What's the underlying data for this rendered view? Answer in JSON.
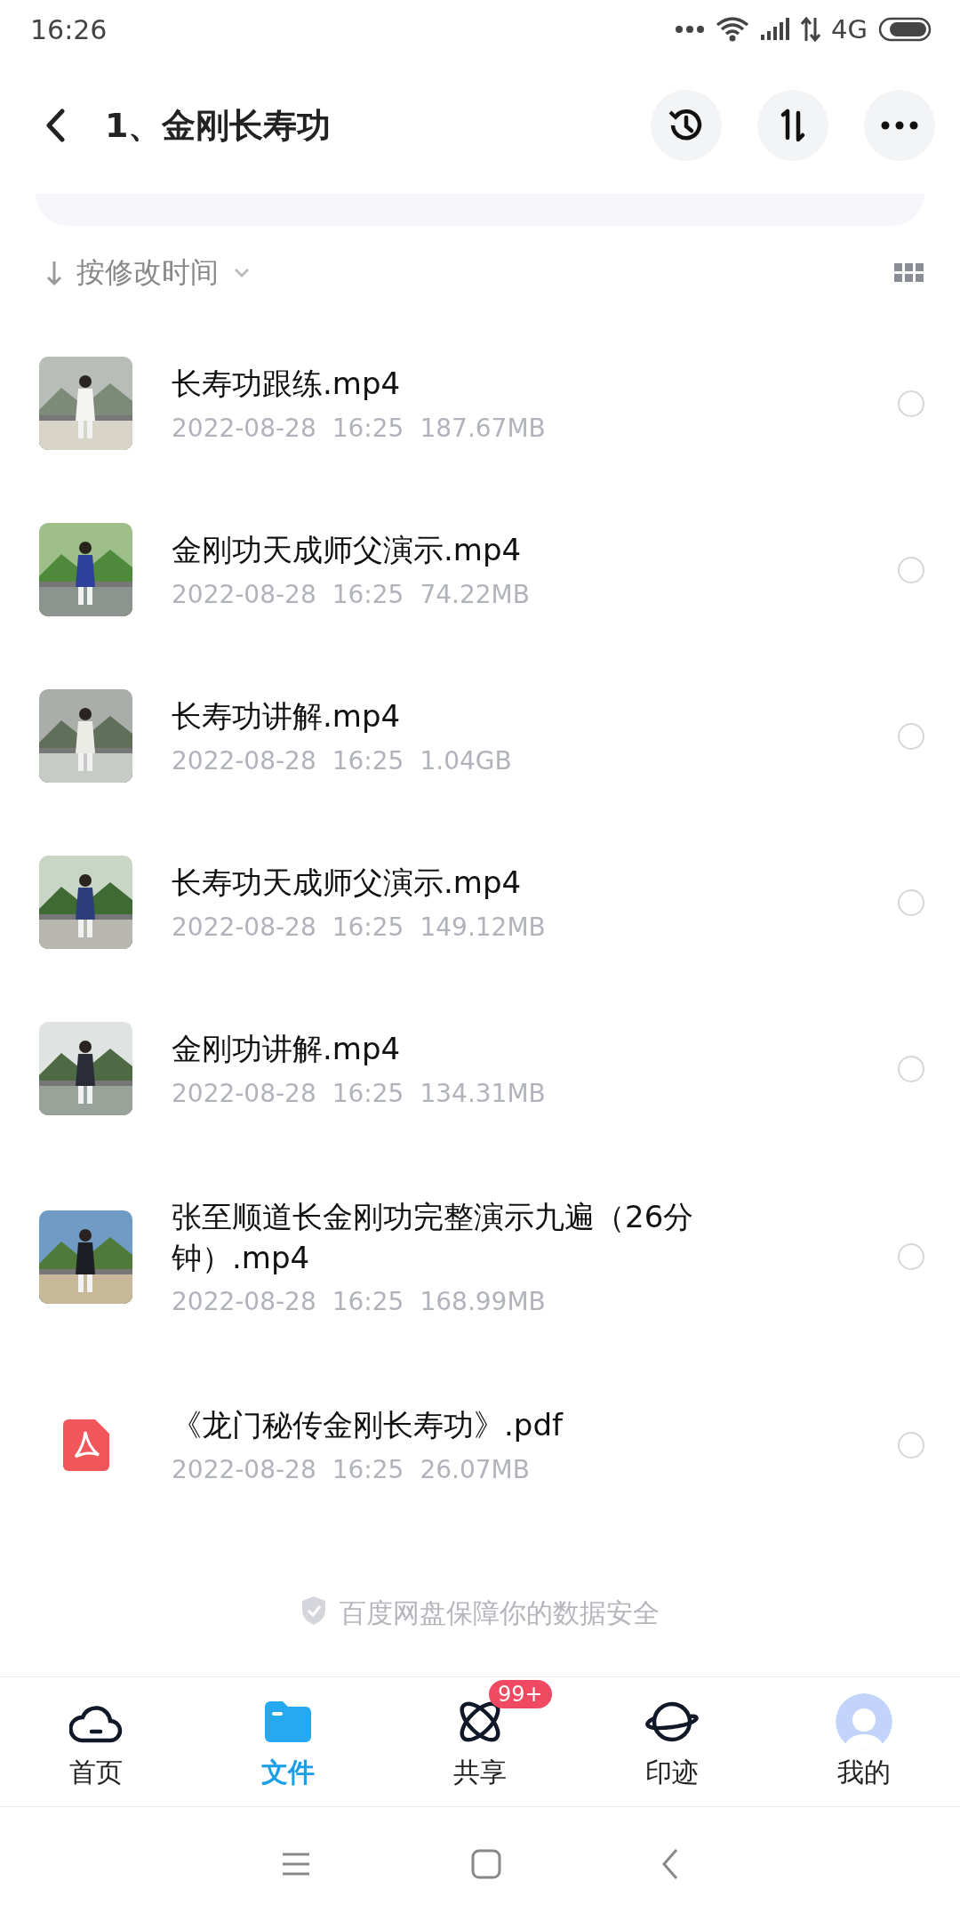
{
  "status_bar": {
    "time": "16:26",
    "network": "4G"
  },
  "header": {
    "title": "1、金刚长寿功"
  },
  "sort": {
    "label": "按修改时间"
  },
  "files": [
    {
      "kind": "video",
      "name": "长寿功跟练.mp4",
      "date": "2022-08-28",
      "time": "16:25",
      "size": "187.67MB",
      "selected": false
    },
    {
      "kind": "video",
      "name": "金刚功天成师父演示.mp4",
      "date": "2022-08-28",
      "time": "16:25",
      "size": "74.22MB",
      "selected": false
    },
    {
      "kind": "video",
      "name": "长寿功讲解.mp4",
      "date": "2022-08-28",
      "time": "16:25",
      "size": "1.04GB",
      "selected": false
    },
    {
      "kind": "video",
      "name": "长寿功天成师父演示.mp4",
      "date": "2022-08-28",
      "time": "16:25",
      "size": "149.12MB",
      "selected": false
    },
    {
      "kind": "video",
      "name": "金刚功讲解.mp4",
      "date": "2022-08-28",
      "time": "16:25",
      "size": "134.31MB",
      "selected": false
    },
    {
      "kind": "video",
      "name": "张至顺道长金刚功完整演示九遍（26分钟）.mp4",
      "date": "2022-08-28",
      "time": "16:25",
      "size": "168.99MB",
      "selected": false
    },
    {
      "kind": "pdf",
      "name": "《龙门秘传金刚长寿功》.pdf",
      "date": "2022-08-28",
      "time": "16:25",
      "size": "26.07MB",
      "selected": false
    }
  ],
  "footer_note": "百度网盘保障你的数据安全",
  "tabs": [
    {
      "label": "首页",
      "selected": false
    },
    {
      "label": "文件",
      "selected": true
    },
    {
      "label": "共享",
      "selected": false,
      "badge": "99+"
    },
    {
      "label": "印迹",
      "selected": false
    },
    {
      "label": "我的",
      "selected": false
    }
  ]
}
